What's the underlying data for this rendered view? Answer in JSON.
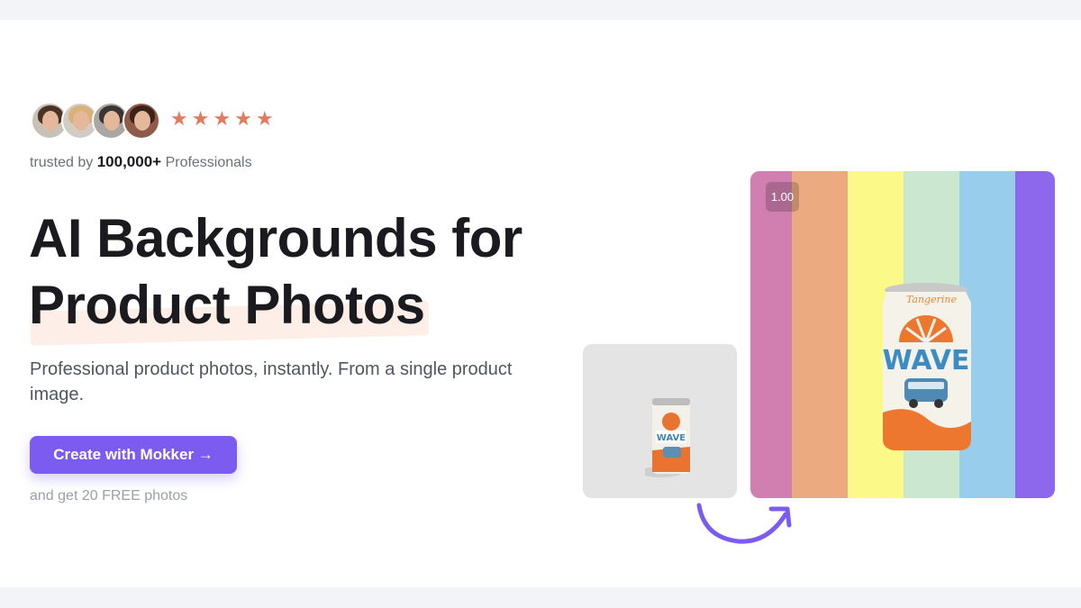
{
  "social_proof": {
    "avatars": [
      {
        "name": "avatar-1",
        "hair": "#4a3324",
        "bg": "#c9c1b6"
      },
      {
        "name": "avatar-2",
        "hair": "#d9b27a",
        "bg": "#d3cbc4"
      },
      {
        "name": "avatar-3",
        "hair": "#3a3633",
        "bg": "#a9a6a3"
      },
      {
        "name": "avatar-4",
        "hair": "#3b2218",
        "bg": "#8e5a49"
      }
    ],
    "stars": [
      "★",
      "★",
      "★",
      "★",
      "★"
    ],
    "rating": 5,
    "trusted_prefix": "trusted by",
    "trusted_count": "100,000+",
    "trusted_suffix": "Professionals"
  },
  "hero": {
    "headline_line1": "AI Backgrounds for",
    "headline_line2": "Product Photos",
    "subtitle": "Professional product photos, instantly. From a single product image.",
    "cta_label": "Create with Mokker →",
    "free_note": "and get 20 FREE photos"
  },
  "preview": {
    "scale_label": "1.00",
    "background_stripes": [
      "#d07fb0",
      "#ecaa80",
      "#fbf988",
      "#cbe7d0",
      "#98cdec",
      "#8e68ec"
    ],
    "can_brand": "WAVE",
    "can_flavor": "Tangerine"
  },
  "colors": {
    "accent": "#7c5cf0",
    "star": "#e07c5e",
    "highlight": "#fdeee7"
  }
}
